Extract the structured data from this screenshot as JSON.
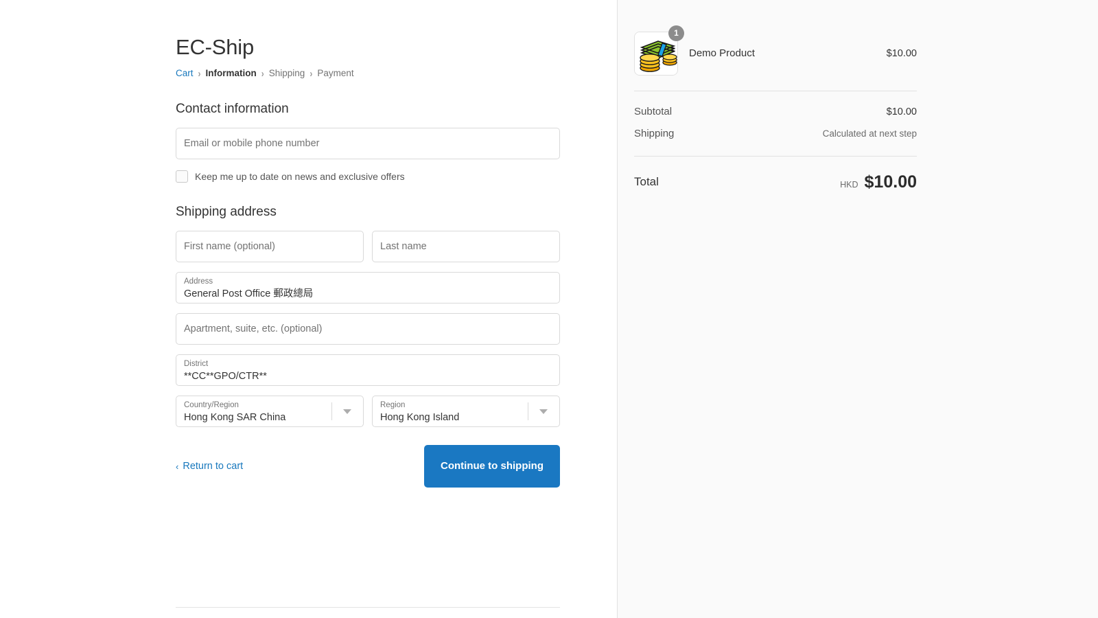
{
  "brand": {
    "title": "EC-Ship"
  },
  "breadcrumb": {
    "items": [
      {
        "label": "Cart",
        "state": "link"
      },
      {
        "label": "Information",
        "state": "current"
      },
      {
        "label": "Shipping",
        "state": "upcoming"
      },
      {
        "label": "Payment",
        "state": "upcoming"
      }
    ],
    "separator": "›"
  },
  "contact": {
    "heading": "Contact information",
    "email_placeholder": "Email or mobile phone number",
    "email_value": "",
    "newsletter_label": "Keep me up to date on news and exclusive offers",
    "newsletter_checked": false
  },
  "shipping": {
    "heading": "Shipping address",
    "first_name_placeholder": "First name (optional)",
    "first_name_value": "",
    "last_name_placeholder": "Last name",
    "last_name_value": "",
    "address_label": "Address",
    "address_value": "General Post Office 郵政總局",
    "apartment_placeholder": "Apartment, suite, etc. (optional)",
    "apartment_value": "",
    "district_label": "District",
    "district_value": "**CC**GPO/CTR**",
    "country_label": "Country/Region",
    "country_value": "Hong Kong SAR China",
    "region_label": "Region",
    "region_value": "Hong Kong Island"
  },
  "actions": {
    "return_to_cart": "Return to cart",
    "return_chevron": "‹",
    "continue_label": "Continue to shipping"
  },
  "summary": {
    "item": {
      "name": "Demo Product",
      "price": "$10.00",
      "quantity": "1",
      "thumbnail_icon": "money-stack-icon"
    },
    "subtotal_label": "Subtotal",
    "subtotal_value": "$10.00",
    "shipping_label": "Shipping",
    "shipping_value": "Calculated at next step",
    "total_label": "Total",
    "total_currency": "HKD",
    "total_value": "$10.00"
  },
  "colors": {
    "accent": "#1a78c2",
    "link": "#1878bd",
    "panel_bg": "#fafafa",
    "border": "#d9d9d9",
    "badge": "#8c8c8c"
  }
}
